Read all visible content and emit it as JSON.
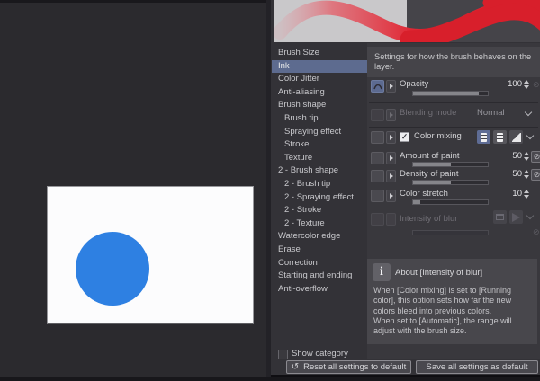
{
  "colors": {
    "selection_accent": "#5d6b8f",
    "canvas_circle": "#2e80e2",
    "preview_stroke_red": "#d81f2b",
    "preview_bg_light": "#c9c8ca",
    "preview_bg_dark": "#454449"
  },
  "icons": {
    "no_dynamics": "⊘",
    "check": "✓",
    "reset": "↺",
    "info": "i"
  },
  "sidebar": {
    "items": [
      {
        "label": "Brush Size",
        "indent": 0,
        "selected": false
      },
      {
        "label": "Ink",
        "indent": 0,
        "selected": true
      },
      {
        "label": "Color Jitter",
        "indent": 0,
        "selected": false
      },
      {
        "label": "Anti-aliasing",
        "indent": 0,
        "selected": false
      },
      {
        "label": "Brush shape",
        "indent": 0,
        "selected": false
      },
      {
        "label": "Brush tip",
        "indent": 1,
        "selected": false
      },
      {
        "label": "Spraying effect",
        "indent": 1,
        "selected": false
      },
      {
        "label": "Stroke",
        "indent": 1,
        "selected": false
      },
      {
        "label": "Texture",
        "indent": 1,
        "selected": false
      },
      {
        "label": "2 - Brush shape",
        "indent": 0,
        "selected": false
      },
      {
        "label": "2 - Brush tip",
        "indent": 1,
        "selected": false
      },
      {
        "label": "2 - Spraying effect",
        "indent": 1,
        "selected": false
      },
      {
        "label": "2 - Stroke",
        "indent": 1,
        "selected": false
      },
      {
        "label": "2 - Texture",
        "indent": 1,
        "selected": false
      },
      {
        "label": "Watercolor edge",
        "indent": 0,
        "selected": false
      },
      {
        "label": "Erase",
        "indent": 0,
        "selected": false
      },
      {
        "label": "Correction",
        "indent": 0,
        "selected": false
      },
      {
        "label": "Starting and ending",
        "indent": 0,
        "selected": false
      },
      {
        "label": "Anti-overflow",
        "indent": 0,
        "selected": false
      }
    ]
  },
  "settings": {
    "header": "Settings for how the brush behaves on the layer.",
    "opacity": {
      "label": "Opacity",
      "value": "100",
      "fill": 88
    },
    "blending_mode": {
      "label": "Blending mode",
      "value": "Normal"
    },
    "color_mixing": {
      "label": "Color mixing",
      "checked": true
    },
    "amount_of_paint": {
      "label": "Amount of paint",
      "value": "50",
      "fill": 50
    },
    "density_of_paint": {
      "label": "Density of paint",
      "value": "50",
      "fill": 50
    },
    "color_stretch": {
      "label": "Color stretch",
      "value": "10",
      "fill": 10
    },
    "intensity_of_blur": {
      "label": "Intensity of blur",
      "fill": 0
    }
  },
  "info_box": {
    "title": "About [Intensity of blur]",
    "body": "When [Color mixing] is set to [Running color], this option sets how far the new colors bleed into previous colors.\nWhen set to [Automatic], the range will adjust with the brush size."
  },
  "footer": {
    "show_category": "Show category",
    "reset_button": "Reset all settings to default",
    "save_button": "Save all settings as default"
  }
}
